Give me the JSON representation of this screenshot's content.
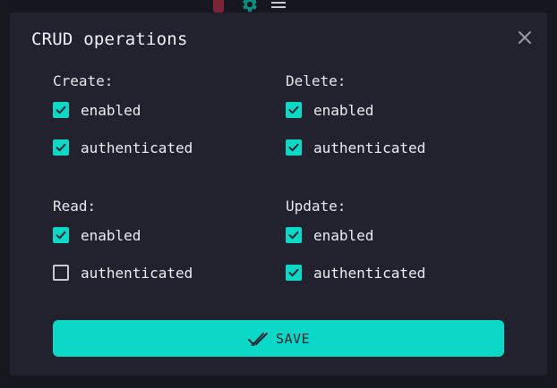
{
  "dialog": {
    "title": "CRUD operations",
    "close_icon": "close-icon"
  },
  "groups": {
    "create": {
      "label": "Create:",
      "enabled": {
        "label": "enabled",
        "checked": true
      },
      "authenticated": {
        "label": "authenticated",
        "checked": true
      }
    },
    "delete": {
      "label": "Delete:",
      "enabled": {
        "label": "enabled",
        "checked": true
      },
      "authenticated": {
        "label": "authenticated",
        "checked": true
      }
    },
    "read": {
      "label": "Read:",
      "enabled": {
        "label": "enabled",
        "checked": true
      },
      "authenticated": {
        "label": "authenticated",
        "checked": false
      }
    },
    "update": {
      "label": "Update:",
      "enabled": {
        "label": "enabled",
        "checked": true
      },
      "authenticated": {
        "label": "authenticated",
        "checked": true
      }
    }
  },
  "save_button": {
    "label": "SAVE",
    "icon": "double-check-icon"
  },
  "colors": {
    "accent": "#0bd8c6",
    "dialog_bg": "#22222f",
    "page_bg": "#17181f"
  }
}
